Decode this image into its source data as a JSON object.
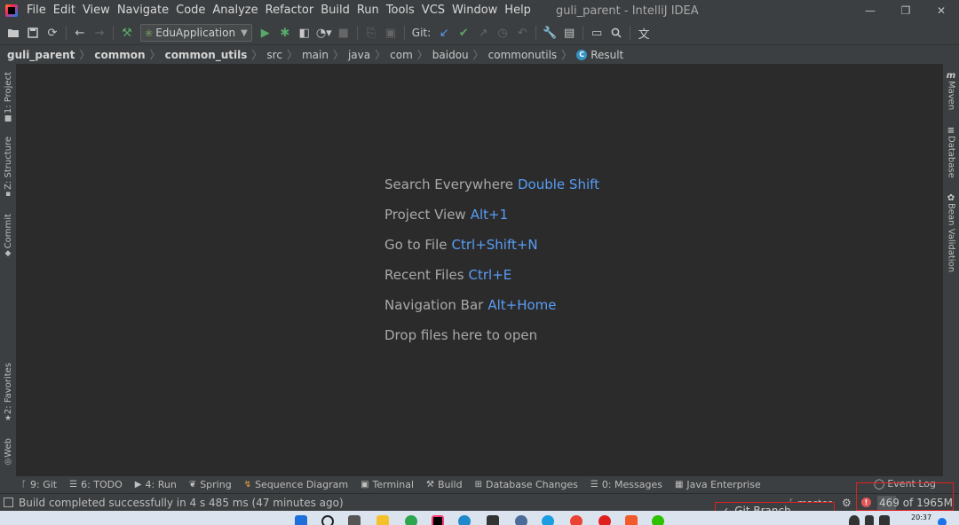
{
  "menu": {
    "items": [
      "File",
      "Edit",
      "View",
      "Navigate",
      "Code",
      "Analyze",
      "Refactor",
      "Build",
      "Run",
      "Tools",
      "VCS",
      "Window",
      "Help"
    ],
    "window_title": "guli_parent - IntelliJ IDEA"
  },
  "window_controls": {
    "minimize": "—",
    "restore": "❐",
    "close": "✕"
  },
  "toolbar": {
    "run_config": "EduApplication",
    "git_label": "Git:"
  },
  "breadcrumb": [
    "guli_parent",
    "common",
    "common_utils",
    "src",
    "main",
    "java",
    "com",
    "baidou",
    "commonutils",
    "Result"
  ],
  "left_tabs": [
    "1: Project",
    "Z: Structure",
    "Commit",
    "2: Favorites",
    "Web"
  ],
  "right_tabs": [
    "Maven",
    "Database",
    "Bean Validation"
  ],
  "hints": [
    {
      "label": "Search Everywhere",
      "key": "Double Shift"
    },
    {
      "label": "Project View",
      "key": "Alt+1"
    },
    {
      "label": "Go to File",
      "key": "Ctrl+Shift+N"
    },
    {
      "label": "Recent Files",
      "key": "Ctrl+E"
    },
    {
      "label": "Navigation Bar",
      "key": "Alt+Home"
    },
    {
      "label": "Drop files here to open",
      "key": ""
    }
  ],
  "bottom_tabs": [
    "9: Git",
    "6: TODO",
    "4: Run",
    "Spring",
    "Sequence Diagram",
    "Terminal",
    "Build",
    "Database Changes",
    "0: Messages",
    "Java Enterprise"
  ],
  "event_log": "Event Log",
  "status": {
    "message": "Build completed successfully in 4 s 485 ms (47 minutes ago)",
    "branch": "master",
    "memory": "469 of 1965M",
    "memory_fraction": 0.239
  },
  "git_popup": {
    "item": "Git Branch"
  },
  "taskbar": {
    "time": "20:37"
  },
  "colors": {
    "accent_blue": "#589df6",
    "highlight_red": "#e02020",
    "background": "#2b2b2b",
    "chrome": "#3c3f41"
  }
}
